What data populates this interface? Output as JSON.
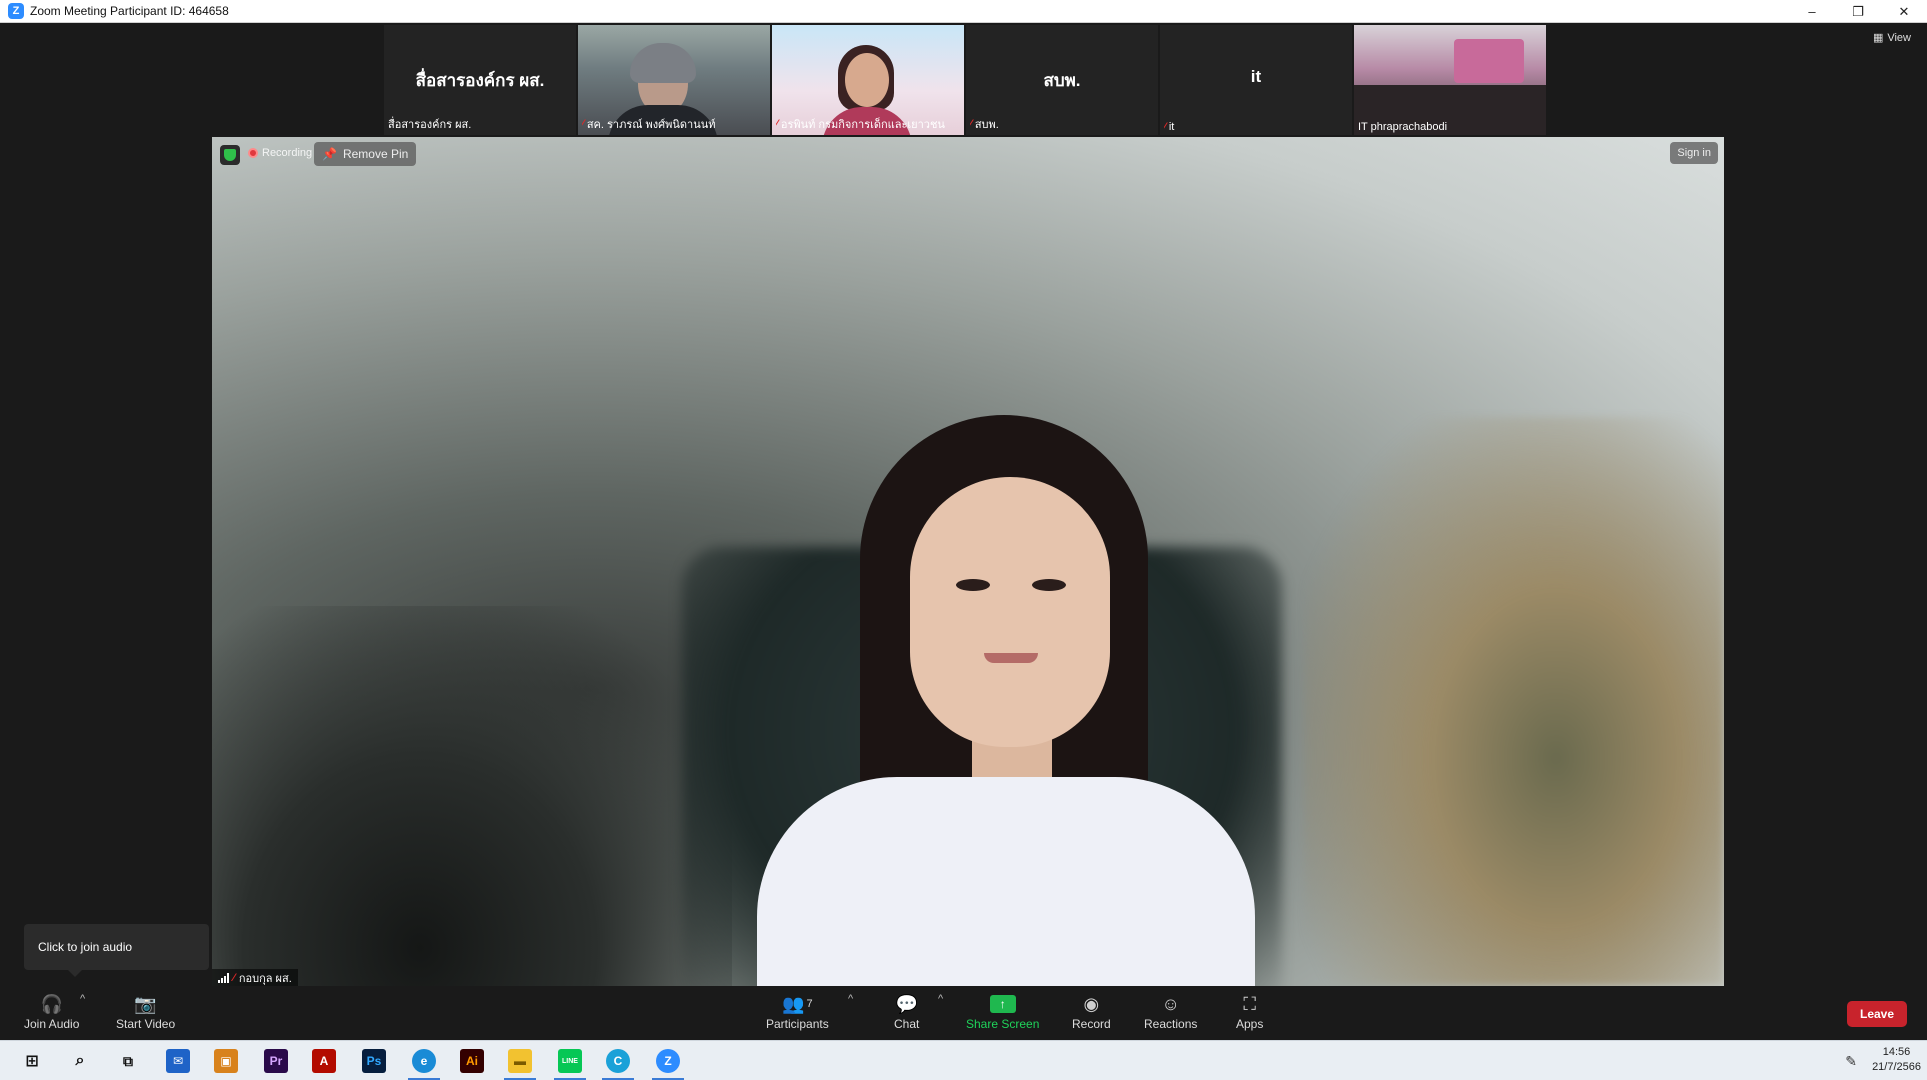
{
  "window": {
    "title": "Zoom Meeting Participant ID: 464658",
    "logo": "Z",
    "minimize": "–",
    "restore": "❐",
    "close": "✕"
  },
  "strip": {
    "view_label": "View",
    "tiles": [
      {
        "big_name": "สื่อสารองค์กร ผส.",
        "label": "สื่อสารองค์กร ผส.",
        "muted": false,
        "kind": "name"
      },
      {
        "big_name": "",
        "label": "สค. ราภรณ์ พงศ์พนิดานนท์",
        "muted": true,
        "kind": "photo1"
      },
      {
        "big_name": "",
        "label": "อรพินท์ กรมกิจการเด็กและเยาวชน",
        "muted": true,
        "kind": "photo2"
      },
      {
        "big_name": "สบพ.",
        "label": "สบพ.",
        "muted": true,
        "kind": "name"
      },
      {
        "big_name": "it",
        "label": "it",
        "muted": true,
        "kind": "name"
      },
      {
        "big_name": "",
        "label": "IT phraprachabodi",
        "muted": false,
        "kind": "photo3"
      }
    ]
  },
  "main_video": {
    "recording_label": "Recording",
    "remove_pin_label": "Remove Pin",
    "sign_in_label": "Sign in",
    "speaker_label": "กอบกุล ผส."
  },
  "tooltip": {
    "text": "Click to join audio"
  },
  "toolbar": {
    "join_audio": "Join Audio",
    "start_video": "Start Video",
    "participants": "Participants",
    "participants_count": "7",
    "chat": "Chat",
    "share_screen": "Share Screen",
    "record": "Record",
    "reactions": "Reactions",
    "apps": "Apps",
    "leave": "Leave"
  },
  "taskbar": {
    "time": "14:56",
    "date": "21/7/2566",
    "apps": [
      {
        "name": "premiere",
        "glyph": "Pr",
        "color": "#2a0a4a"
      },
      {
        "name": "acrobat",
        "glyph": "A",
        "color": "#b30b00"
      },
      {
        "name": "photoshop",
        "glyph": "Ps",
        "color": "#061e3e"
      },
      {
        "name": "illustrator",
        "glyph": "Ai",
        "color": "#330000"
      },
      {
        "name": "line",
        "glyph": "LINE",
        "color": "#06c755"
      }
    ]
  }
}
